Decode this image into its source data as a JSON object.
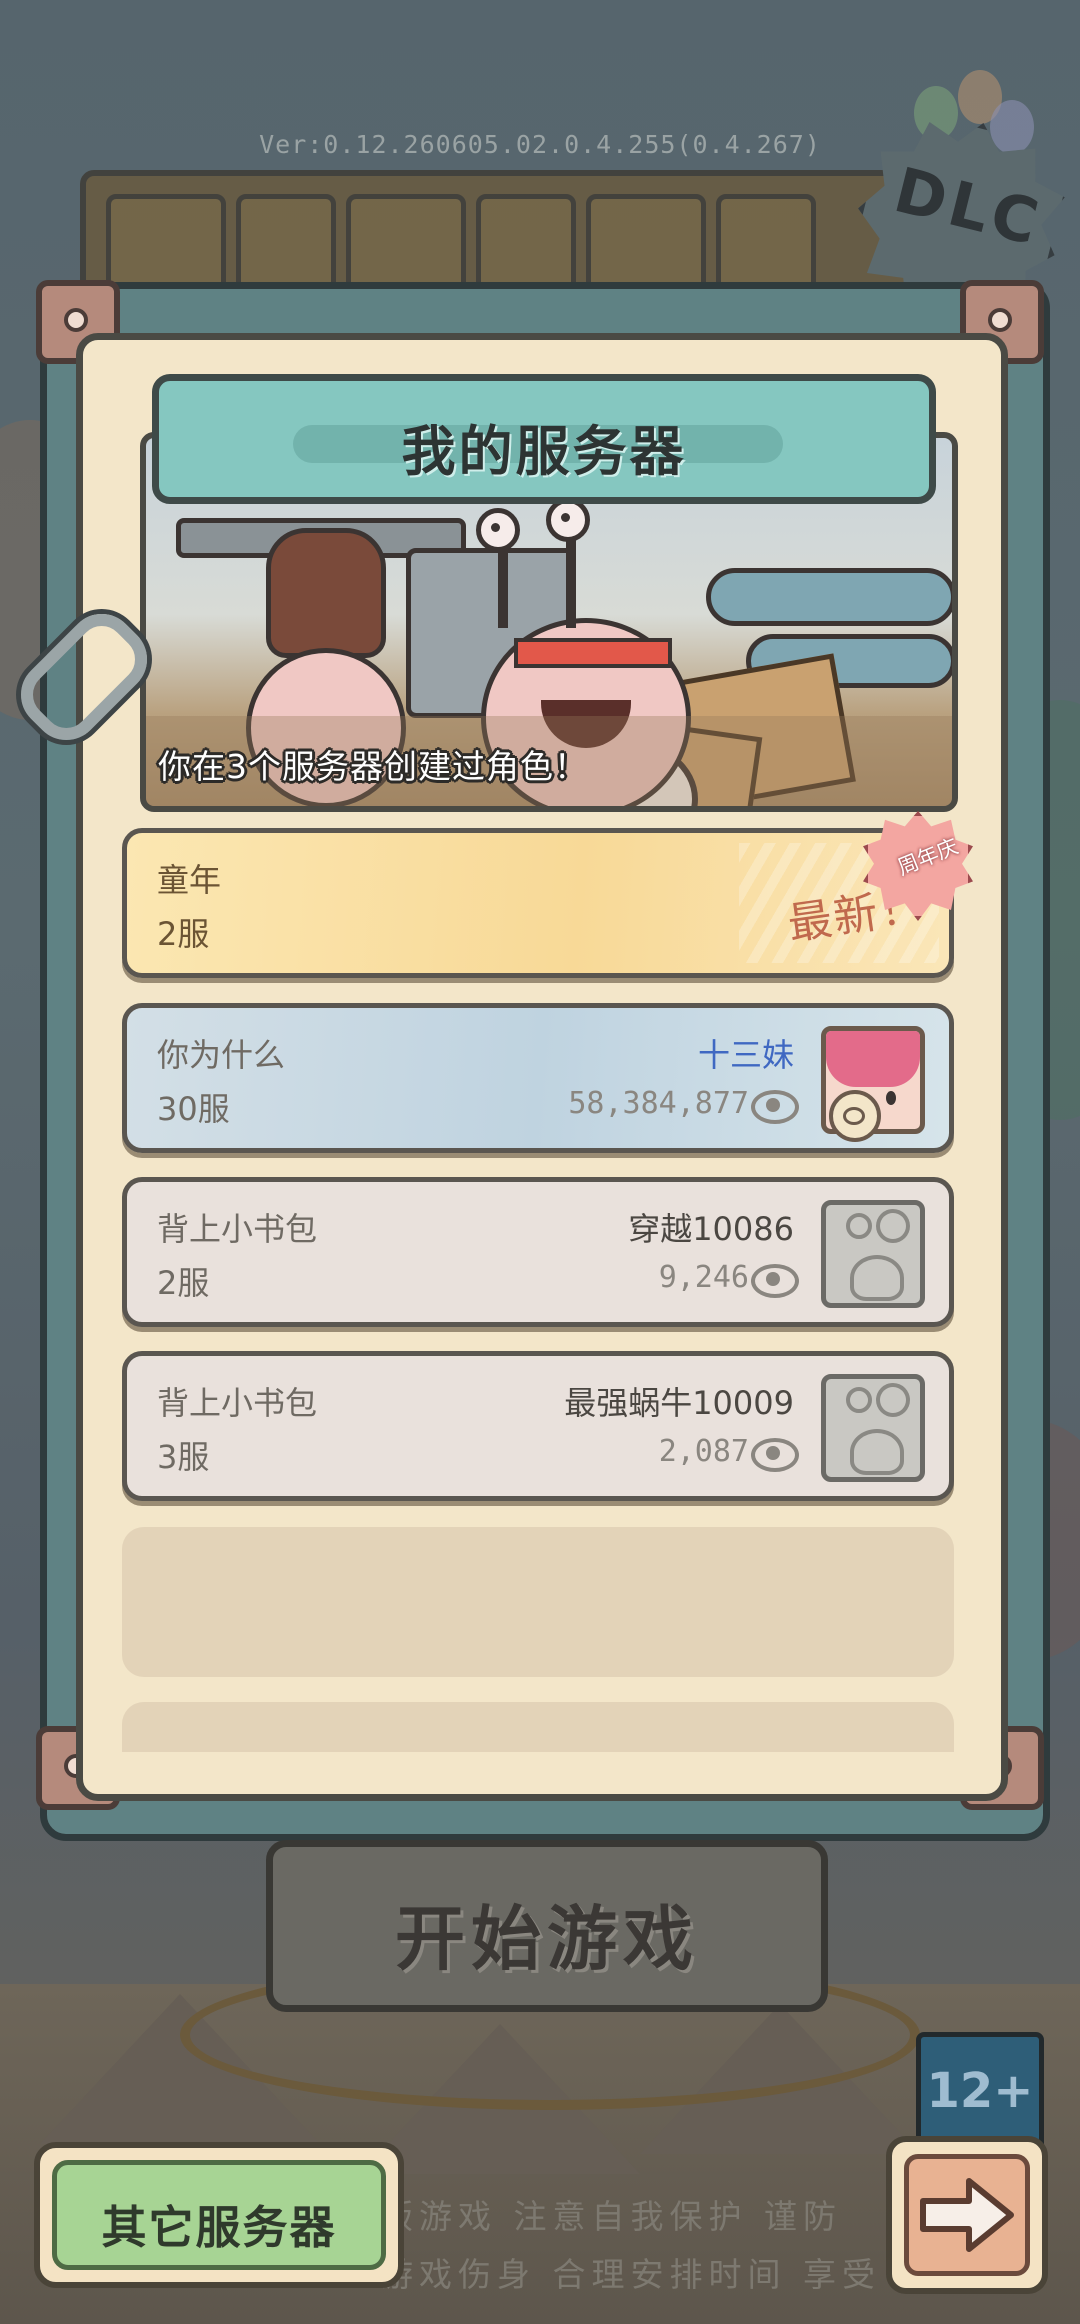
{
  "version": "Ver:0.12.260605.02.0.4.255(0.4.267)",
  "dlc_badge": "DLC",
  "panel": {
    "title": "我的服务器",
    "banner_caption": "你在3个服务器创建过角色！"
  },
  "servers": [
    {
      "name": "童年",
      "zone": "2服",
      "tag": "最新！",
      "badge": "周年庆",
      "style": "featured"
    },
    {
      "name": "你为什么",
      "zone": "30服",
      "character": "十三妹",
      "power": "58,384,877",
      "avatar": "pink-hair-girl",
      "style": "selected"
    },
    {
      "name": "背上小书包",
      "zone": "2服",
      "character": "穿越10086",
      "power": "9,246",
      "avatar": "snail-placeholder",
      "style": "normal"
    },
    {
      "name": "背上小书包",
      "zone": "3服",
      "character": "最强蜗牛10009",
      "power": "2,087",
      "avatar": "snail-placeholder",
      "style": "normal"
    }
  ],
  "buttons": {
    "start": "开始游戏",
    "other_servers": "其它服务器",
    "next_icon": "arrow-right-icon"
  },
  "age_rating": "12+",
  "notice": {
    "line1": "版游戏 注意自我保护 谨防",
    "line2": "游戏伤身 合理安排时间 享受"
  },
  "colors": {
    "title_bar": "#85c7c0",
    "panel_bg": "#f3e6c9",
    "vip_name": "#3f68c2",
    "newest_tag": "#c0694d",
    "other_button": "#a7d494",
    "next_button": "#e8b292"
  }
}
